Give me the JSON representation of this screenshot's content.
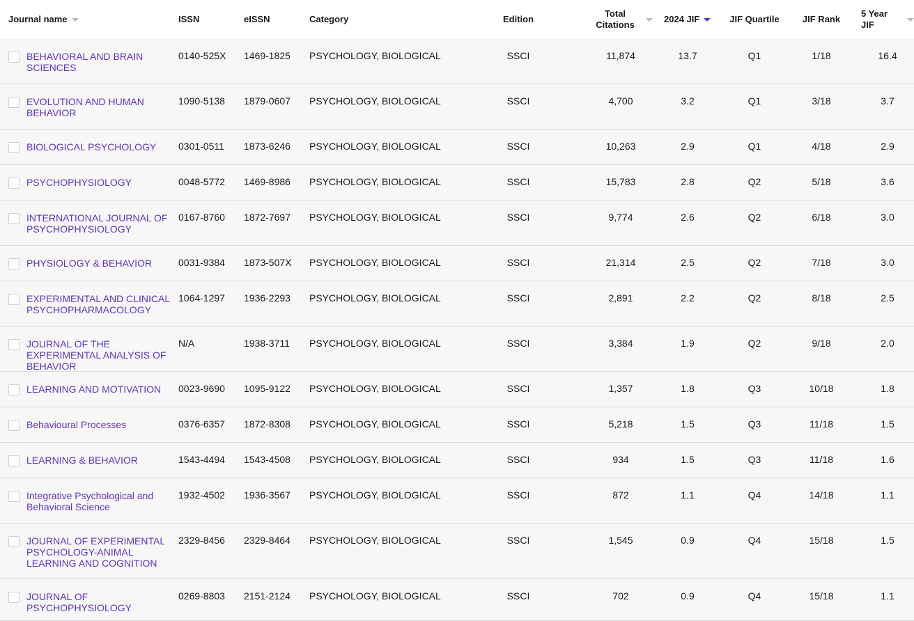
{
  "columns": {
    "journal_name": "Journal name",
    "issn": "ISSN",
    "eissn": "eISSN",
    "category": "Category",
    "edition": "Edition",
    "total_citations": "Total Citations",
    "jif_2024": "2024 JIF",
    "jif_quartile": "JIF Quartile",
    "jif_rank": "JIF Rank",
    "five_year_jif": "5 Year JIF"
  },
  "colors": {
    "link": "#5e33bf",
    "row_bg": "#f7f7f7",
    "sort_active": "#5e33bf"
  },
  "rows": [
    {
      "name": "BEHAVIORAL AND BRAIN SCIENCES",
      "issn": "0140-525X",
      "eissn": "1469-1825",
      "category": "PSYCHOLOGY, BIOLOGICAL",
      "edition": "SSCI",
      "citations": "11,874",
      "jif": "13.7",
      "quartile": "Q1",
      "rank": "1/18",
      "jif5": "16.4"
    },
    {
      "name": "EVOLUTION AND HUMAN BEHAVIOR",
      "issn": "1090-5138",
      "eissn": "1879-0607",
      "category": "PSYCHOLOGY, BIOLOGICAL",
      "edition": "SSCI",
      "citations": "4,700",
      "jif": "3.2",
      "quartile": "Q1",
      "rank": "3/18",
      "jif5": "3.7"
    },
    {
      "name": "BIOLOGICAL PSYCHOLOGY",
      "issn": "0301-0511",
      "eissn": "1873-6246",
      "category": "PSYCHOLOGY, BIOLOGICAL",
      "edition": "SSCI",
      "citations": "10,263",
      "jif": "2.9",
      "quartile": "Q1",
      "rank": "4/18",
      "jif5": "2.9"
    },
    {
      "name": "PSYCHOPHYSIOLOGY",
      "issn": "0048-5772",
      "eissn": "1469-8986",
      "category": "PSYCHOLOGY, BIOLOGICAL",
      "edition": "SSCI",
      "citations": "15,783",
      "jif": "2.8",
      "quartile": "Q2",
      "rank": "5/18",
      "jif5": "3.6"
    },
    {
      "name": "INTERNATIONAL JOURNAL OF PSYCHOPHYSIOLOGY",
      "issn": "0167-8760",
      "eissn": "1872-7697",
      "category": "PSYCHOLOGY, BIOLOGICAL",
      "edition": "SSCI",
      "citations": "9,774",
      "jif": "2.6",
      "quartile": "Q2",
      "rank": "6/18",
      "jif5": "3.0"
    },
    {
      "name": "PHYSIOLOGY & BEHAVIOR",
      "issn": "0031-9384",
      "eissn": "1873-507X",
      "category": "PSYCHOLOGY, BIOLOGICAL",
      "edition": "SSCI",
      "citations": "21,314",
      "jif": "2.5",
      "quartile": "Q2",
      "rank": "7/18",
      "jif5": "3.0"
    },
    {
      "name": "EXPERIMENTAL AND CLINICAL PSYCHOPHARMACOLOGY",
      "issn": "1064-1297",
      "eissn": "1936-2293",
      "category": "PSYCHOLOGY, BIOLOGICAL",
      "edition": "SSCI",
      "citations": "2,891",
      "jif": "2.2",
      "quartile": "Q2",
      "rank": "8/18",
      "jif5": "2.5"
    },
    {
      "name": "JOURNAL OF THE EXPERIMENTAL ANALYSIS OF BEHAVIOR",
      "issn": "N/A",
      "eissn": "1938-3711",
      "category": "PSYCHOLOGY, BIOLOGICAL",
      "edition": "SSCI",
      "citations": "3,384",
      "jif": "1.9",
      "quartile": "Q2",
      "rank": "9/18",
      "jif5": "2.0"
    },
    {
      "name": "LEARNING AND MOTIVATION",
      "issn": "0023-9690",
      "eissn": "1095-9122",
      "category": "PSYCHOLOGY, BIOLOGICAL",
      "edition": "SSCI",
      "citations": "1,357",
      "jif": "1.8",
      "quartile": "Q3",
      "rank": "10/18",
      "jif5": "1.8"
    },
    {
      "name": "Behavioural Processes",
      "issn": "0376-6357",
      "eissn": "1872-8308",
      "category": "PSYCHOLOGY, BIOLOGICAL",
      "edition": "SSCI",
      "citations": "5,218",
      "jif": "1.5",
      "quartile": "Q3",
      "rank": "11/18",
      "jif5": "1.5"
    },
    {
      "name": "LEARNING & BEHAVIOR",
      "issn": "1543-4494",
      "eissn": "1543-4508",
      "category": "PSYCHOLOGY, BIOLOGICAL",
      "edition": "SSCI",
      "citations": "934",
      "jif": "1.5",
      "quartile": "Q3",
      "rank": "11/18",
      "jif5": "1.6"
    },
    {
      "name": "Integrative Psychological and Behavioral Science",
      "issn": "1932-4502",
      "eissn": "1936-3567",
      "category": "PSYCHOLOGY, BIOLOGICAL",
      "edition": "SSCI",
      "citations": "872",
      "jif": "1.1",
      "quartile": "Q4",
      "rank": "14/18",
      "jif5": "1.1"
    },
    {
      "name": "JOURNAL OF EXPERIMENTAL PSYCHOLOGY-ANIMAL LEARNING AND COGNITION",
      "issn": "2329-8456",
      "eissn": "2329-8464",
      "category": "PSYCHOLOGY, BIOLOGICAL",
      "edition": "SSCI",
      "citations": "1,545",
      "jif": "0.9",
      "quartile": "Q4",
      "rank": "15/18",
      "jif5": "1.5"
    },
    {
      "name": "JOURNAL OF PSYCHOPHYSIOLOGY",
      "issn": "0269-8803",
      "eissn": "2151-2124",
      "category": "PSYCHOLOGY, BIOLOGICAL",
      "edition": "SSCI",
      "citations": "702",
      "jif": "0.9",
      "quartile": "Q4",
      "rank": "15/18",
      "jif5": "1.1"
    }
  ]
}
